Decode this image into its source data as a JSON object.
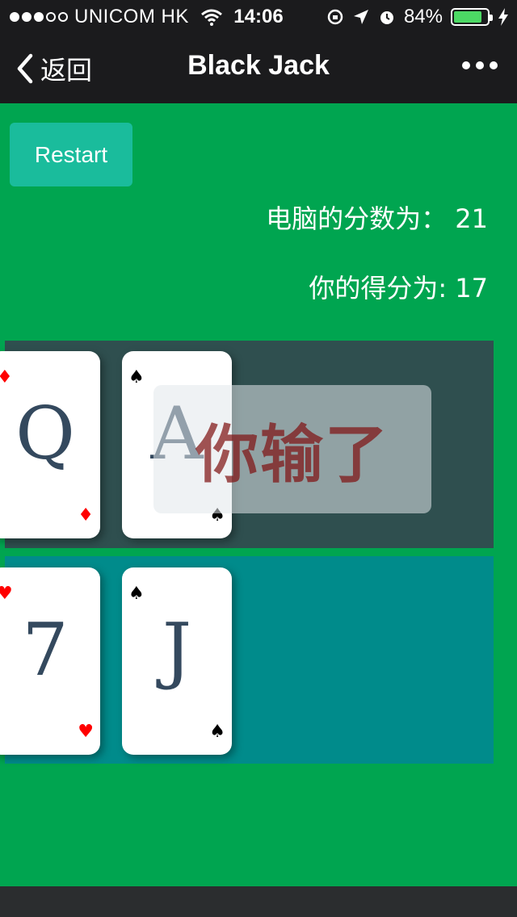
{
  "status_bar": {
    "carrier": "UNICOM HK",
    "time": "14:06",
    "battery_text": "84%",
    "battery_level": 0.84,
    "signal_bars_filled": 3,
    "signal_bars_total": 5
  },
  "nav": {
    "back_label": "返回",
    "title": "Black Jack"
  },
  "game": {
    "restart_label": "Restart",
    "computer_score_label": "电脑的分数为：",
    "computer_score": "21",
    "player_score_label": "你的得分为:",
    "player_score": "17",
    "result_text": "你输了",
    "dealer_hand": [
      {
        "rank": "Q",
        "suit": "♦",
        "color": "red"
      },
      {
        "rank": "A",
        "suit": "♠",
        "color": "black"
      }
    ],
    "player_hand": [
      {
        "rank": "7",
        "suit": "♥",
        "color": "red"
      },
      {
        "rank": "J",
        "suit": "♠",
        "color": "black"
      }
    ]
  },
  "colors": {
    "background": "#00A550",
    "bar": "#1B1B1D",
    "restart_button": "#1ABC9C",
    "dealer_zone": "#2F4F4F",
    "player_zone": "#008B8B"
  }
}
